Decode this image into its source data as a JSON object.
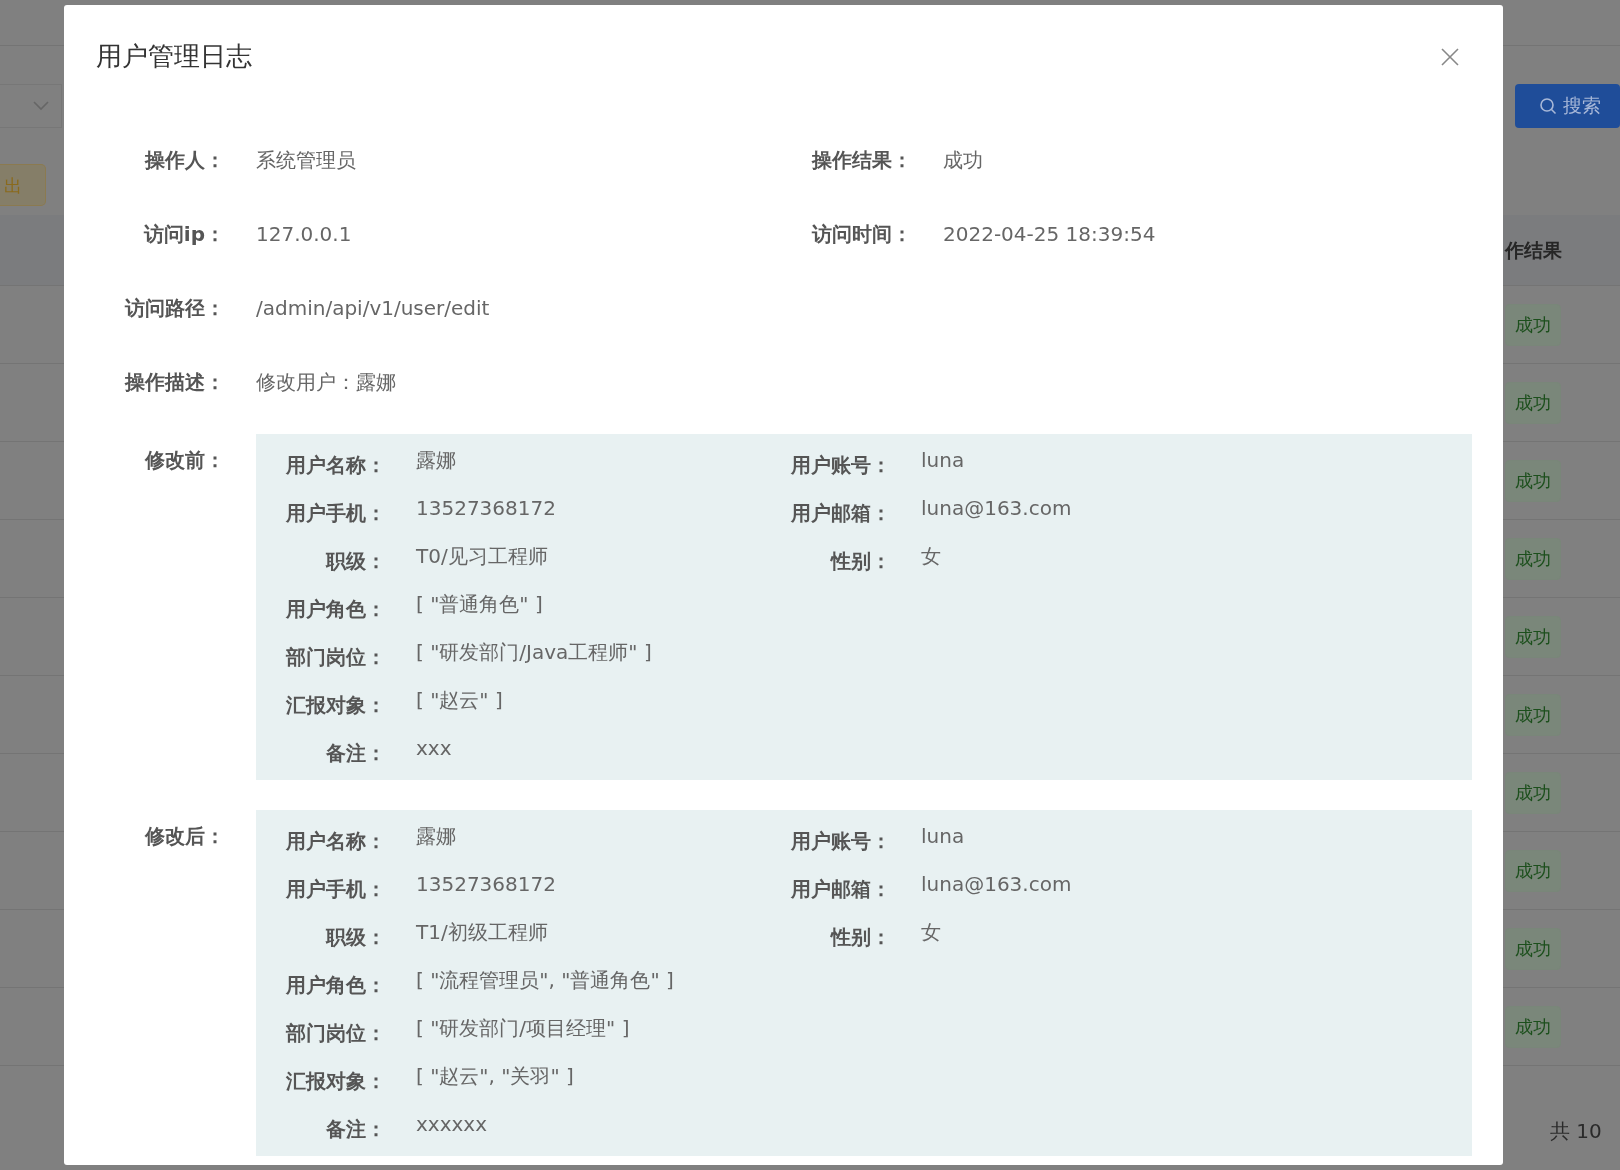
{
  "background": {
    "export_button": "出",
    "search_button": "搜索",
    "column_header": "作结果",
    "rows": [
      {
        "result": "成功"
      },
      {
        "result": "成功"
      },
      {
        "result": "成功"
      },
      {
        "result": "成功"
      },
      {
        "result": "成功"
      },
      {
        "result": "成功"
      },
      {
        "result": "成功"
      },
      {
        "result": "成功"
      },
      {
        "result": "成功"
      },
      {
        "result": "成功"
      }
    ],
    "pagination_total": "共 10"
  },
  "dialog": {
    "title": "用户管理日志",
    "info_rows": [
      [
        {
          "label": "操作人：",
          "value": "系统管理员"
        },
        {
          "label": "操作结果：",
          "value": "成功"
        }
      ],
      [
        {
          "label": "访问ip：",
          "value": "127.0.0.1"
        },
        {
          "label": "访问时间：",
          "value": "2022-04-25 18:39:54"
        }
      ],
      [
        {
          "label": "访问路径：",
          "value": "/admin/api/v1/user/edit"
        }
      ],
      [
        {
          "label": "操作描述：",
          "value": "修改用户：露娜"
        }
      ]
    ],
    "changes": [
      {
        "label": "修改前：",
        "rows": [
          [
            {
              "label": "用户名称：",
              "value": "露娜"
            },
            {
              "label": "用户账号：",
              "value": "luna"
            }
          ],
          [
            {
              "label": "用户手机：",
              "value": "13527368172"
            },
            {
              "label": "用户邮箱：",
              "value": "luna@163.com"
            }
          ],
          [
            {
              "label": "职级：",
              "value": "T0/见习工程师"
            },
            {
              "label": "性别：",
              "value": "女"
            }
          ],
          [
            {
              "label": "用户角色：",
              "value": "[ \"普通角色\" ]"
            }
          ],
          [
            {
              "label": "部门岗位：",
              "value": "[ \"研发部门/Java工程师\" ]"
            }
          ],
          [
            {
              "label": "汇报对象：",
              "value": "[ \"赵云\" ]"
            }
          ],
          [
            {
              "label": "备注：",
              "value": "xxx"
            }
          ]
        ]
      },
      {
        "label": "修改后：",
        "rows": [
          [
            {
              "label": "用户名称：",
              "value": "露娜"
            },
            {
              "label": "用户账号：",
              "value": "luna"
            }
          ],
          [
            {
              "label": "用户手机：",
              "value": "13527368172"
            },
            {
              "label": "用户邮箱：",
              "value": "luna@163.com"
            }
          ],
          [
            {
              "label": "职级：",
              "value": "T1/初级工程师"
            },
            {
              "label": "性别：",
              "value": "女"
            }
          ],
          [
            {
              "label": "用户角色：",
              "value": "[ \"流程管理员\", \"普通角色\" ]"
            }
          ],
          [
            {
              "label": "部门岗位：",
              "value": "[ \"研发部门/项目经理\" ]"
            }
          ],
          [
            {
              "label": "汇报对象：",
              "value": "[ \"赵云\", \"关羽\" ]"
            }
          ],
          [
            {
              "label": "备注：",
              "value": "xxxxxx"
            }
          ]
        ]
      }
    ]
  }
}
